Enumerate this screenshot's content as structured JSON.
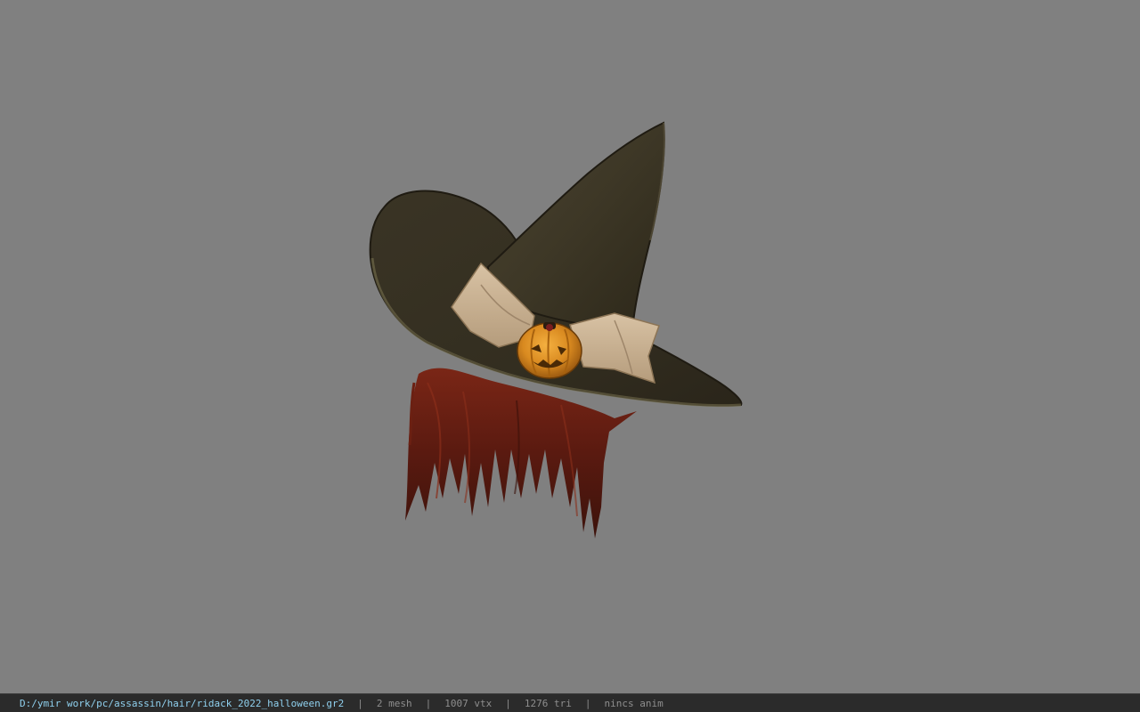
{
  "viewport": {
    "background_color": "#808080",
    "model_name": "witch-hat-hair-model"
  },
  "status_bar": {
    "file_path": "D:/ymir work/pc/assassin/hair/ridack_2022_halloween.gr2",
    "separator": "|",
    "mesh_count": "2 mesh",
    "vertex_count": "1007 vtx",
    "triangle_count": "1276 tri",
    "animation_status": "nincs anim",
    "path_color": "#8fd0ee",
    "text_color": "#8e8e8e",
    "background_color": "#2b2b2b"
  }
}
